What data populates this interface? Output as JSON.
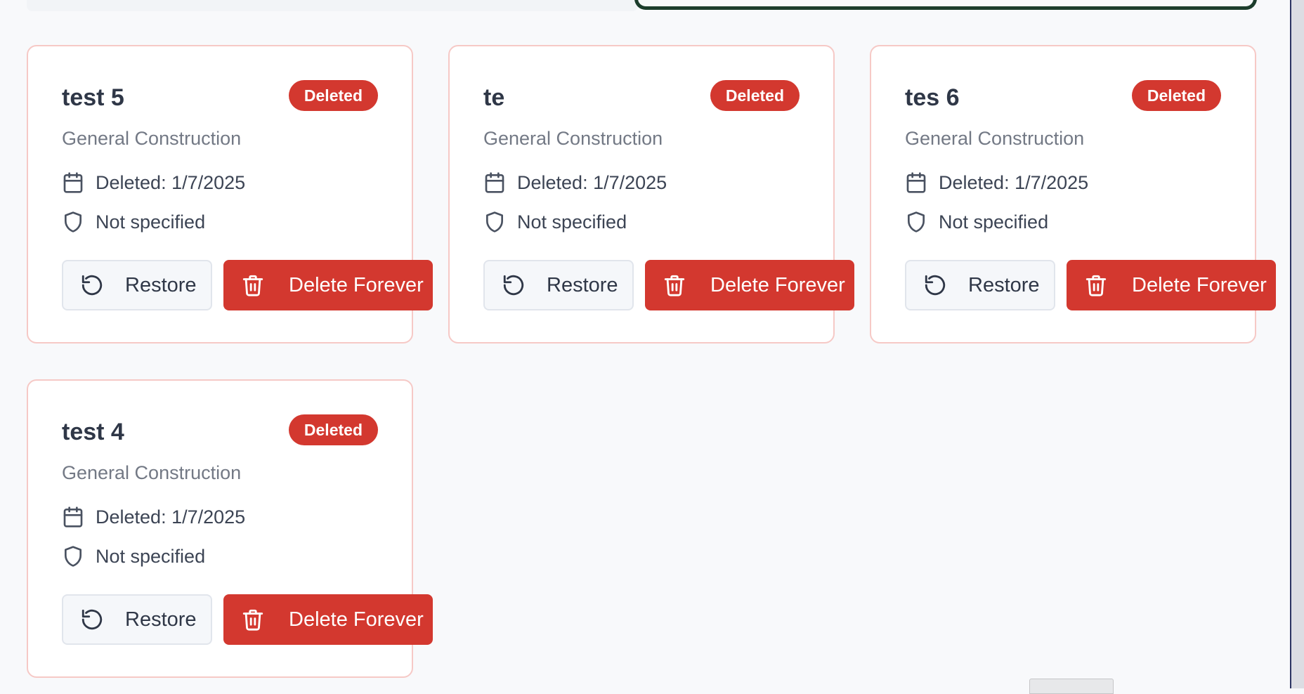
{
  "cards": [
    {
      "title": "test 5",
      "badge": "Deleted",
      "category": "General Construction",
      "deleted_text": "Deleted: 1/7/2025",
      "type_text": "Not specified",
      "restore_label": "Restore",
      "delete_label": "Delete Forever"
    },
    {
      "title": "te",
      "badge": "Deleted",
      "category": "General Construction",
      "deleted_text": "Deleted: 1/7/2025",
      "type_text": "Not specified",
      "restore_label": "Restore",
      "delete_label": "Delete Forever"
    },
    {
      "title": "tes 6",
      "badge": "Deleted",
      "category": "General Construction",
      "deleted_text": "Deleted: 1/7/2025",
      "type_text": "Not specified",
      "restore_label": "Restore",
      "delete_label": "Delete Forever"
    },
    {
      "title": "test 4",
      "badge": "Deleted",
      "category": "General Construction",
      "deleted_text": "Deleted: 1/7/2025",
      "type_text": "Not specified",
      "restore_label": "Restore",
      "delete_label": "Delete Forever"
    }
  ],
  "icons": {
    "date": "calendar-icon",
    "type": "shield-icon",
    "restore": "rotate-ccw-icon",
    "delete": "trash-icon"
  },
  "colors": {
    "accent": "#d3382f",
    "card_border": "#f6c9c6",
    "search_outline": "#1c3d2c"
  }
}
